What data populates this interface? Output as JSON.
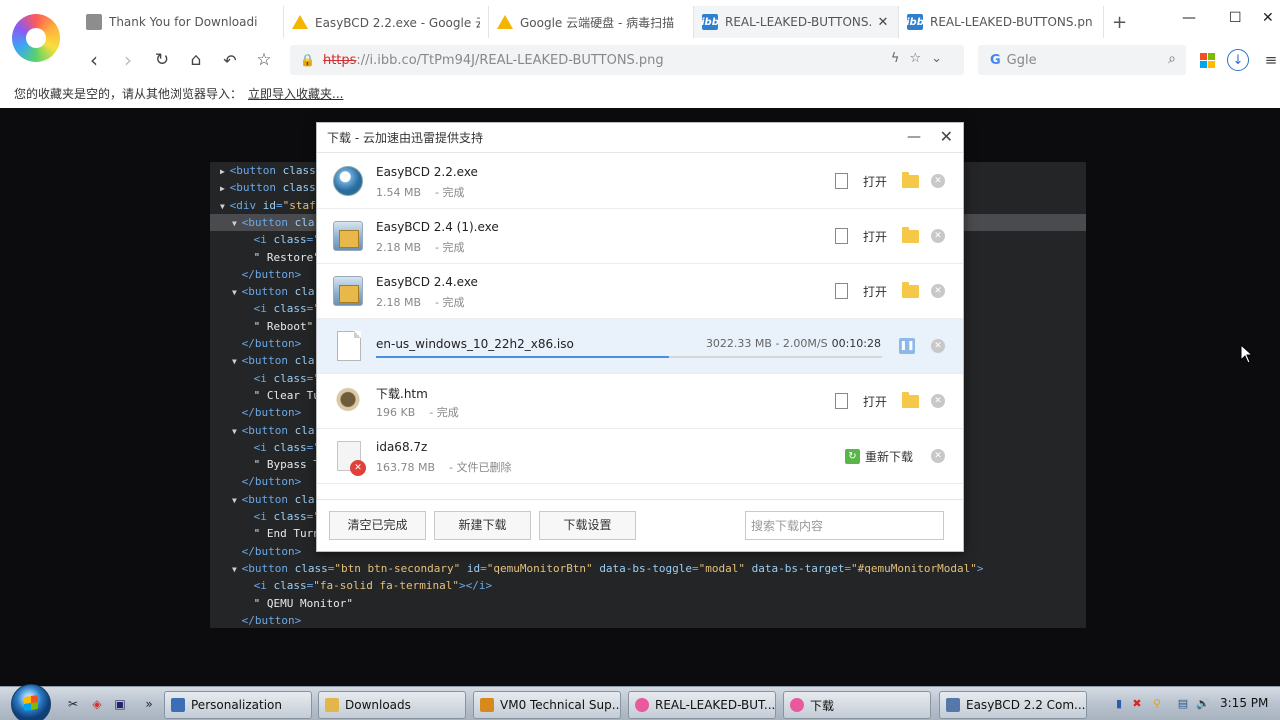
{
  "browser": {
    "tabs": [
      {
        "label": "Thank You for Downloadi",
        "favicon": "document-icon"
      },
      {
        "label": "EasyBCD 2.2.exe - Google 云",
        "favicon": "google-drive-icon"
      },
      {
        "label": "Google 云端硬盘 - 病毒扫描",
        "favicon": "google-drive-icon"
      },
      {
        "label": "REAL-LEAKED-BUTTONS.pn",
        "favicon": "ibb-icon",
        "active": true
      },
      {
        "label": "REAL-LEAKED-BUTTONS.pn",
        "favicon": "ibb-icon"
      }
    ],
    "new_tab": "+",
    "address": {
      "scheme": "https",
      "rest": "://i.ibb.co/TtPm94J/REAL-LEAKED-BUTTONS.png"
    },
    "search": {
      "engine_glyph": "G",
      "placeholder": "Ggle"
    },
    "bookmark_bar": {
      "message": "您的收藏夹是空的，请从其他浏览器导入：",
      "link": "立即导入收藏夹..."
    }
  },
  "code_view": {
    "lines": [
      {
        "indent": 1,
        "triangle": "▶",
        "segments": [
          [
            "tag",
            "<button "
          ],
          [
            "attr-name",
            "class"
          ]
        ]
      },
      {
        "indent": 1,
        "triangle": "▶",
        "segments": [
          [
            "tag",
            "<button "
          ],
          [
            "attr-name",
            "class"
          ]
        ]
      },
      {
        "indent": 1,
        "triangle": "▼",
        "segments": [
          [
            "tag",
            "<div "
          ],
          [
            "attr-name",
            "id"
          ],
          [
            "tag",
            "="
          ],
          [
            "attr-val",
            "\"staf"
          ]
        ]
      },
      {
        "indent": 2,
        "triangle": "▼",
        "segments": [
          [
            "tag",
            "<button "
          ],
          [
            "attr-name",
            "cla"
          ]
        ],
        "highlight": true
      },
      {
        "indent": 3,
        "triangle": "",
        "segments": [
          [
            "tag",
            "<i "
          ],
          [
            "attr-name",
            "class"
          ],
          [
            "tag",
            "=\""
          ]
        ]
      },
      {
        "indent": 3,
        "triangle": "",
        "segments": [
          [
            "text",
            "\" Restore\""
          ]
        ]
      },
      {
        "indent": 2,
        "triangle": "",
        "segments": [
          [
            "tag",
            "</button>"
          ]
        ]
      },
      {
        "indent": 2,
        "triangle": "▼",
        "segments": [
          [
            "tag",
            "<button "
          ],
          [
            "attr-name",
            "cla"
          ]
        ]
      },
      {
        "indent": 3,
        "triangle": "",
        "segments": [
          [
            "tag",
            "<i "
          ],
          [
            "attr-name",
            "class"
          ],
          [
            "tag",
            "=\""
          ]
        ]
      },
      {
        "indent": 3,
        "triangle": "",
        "segments": [
          [
            "text",
            "\" Reboot\""
          ]
        ]
      },
      {
        "indent": 2,
        "triangle": "",
        "segments": [
          [
            "tag",
            "</button>"
          ]
        ]
      },
      {
        "indent": 2,
        "triangle": "▼",
        "segments": [
          [
            "tag",
            "<button "
          ],
          [
            "attr-name",
            "cla"
          ]
        ]
      },
      {
        "indent": 3,
        "triangle": "",
        "segments": [
          [
            "tag",
            "<i "
          ],
          [
            "attr-name",
            "class"
          ],
          [
            "tag",
            "=\""
          ]
        ]
      },
      {
        "indent": 3,
        "triangle": "",
        "segments": [
          [
            "text",
            "\" Clear Tu"
          ]
        ]
      },
      {
        "indent": 2,
        "triangle": "",
        "segments": [
          [
            "tag",
            "</button>"
          ]
        ]
      },
      {
        "indent": 2,
        "triangle": "▼",
        "segments": [
          [
            "tag",
            "<button "
          ],
          [
            "attr-name",
            "cla"
          ]
        ]
      },
      {
        "indent": 3,
        "triangle": "",
        "segments": [
          [
            "tag",
            "<i "
          ],
          [
            "attr-name",
            "class"
          ],
          [
            "tag",
            "=\""
          ]
        ]
      },
      {
        "indent": 3,
        "triangle": "",
        "segments": [
          [
            "text",
            "\" Bypass T"
          ]
        ]
      },
      {
        "indent": 2,
        "triangle": "",
        "segments": [
          [
            "tag",
            "</button>"
          ]
        ]
      },
      {
        "indent": 2,
        "triangle": "▼",
        "segments": [
          [
            "tag",
            "<button "
          ],
          [
            "attr-name",
            "cla"
          ]
        ]
      },
      {
        "indent": 3,
        "triangle": "",
        "segments": [
          [
            "tag",
            "<i "
          ],
          [
            "attr-name",
            "class"
          ],
          [
            "tag",
            "=\""
          ]
        ]
      },
      {
        "indent": 3,
        "triangle": "",
        "segments": [
          [
            "text",
            "\" End Turn"
          ]
        ]
      },
      {
        "indent": 2,
        "triangle": "",
        "segments": [
          [
            "tag",
            "</button>"
          ]
        ]
      },
      {
        "indent": 2,
        "triangle": "▼",
        "segments": [
          [
            "tag",
            "<button "
          ],
          [
            "attr-name",
            "class"
          ],
          [
            "tag",
            "="
          ],
          [
            "attr-val",
            "\"btn btn-secondary\""
          ],
          [
            "tag",
            " "
          ],
          [
            "attr-name",
            "id"
          ],
          [
            "tag",
            "="
          ],
          [
            "attr-val",
            "\"qemuMonitorBtn\""
          ],
          [
            "tag",
            " "
          ],
          [
            "attr-name",
            "data-bs-toggle"
          ],
          [
            "tag",
            "="
          ],
          [
            "attr-val",
            "\"modal\""
          ],
          [
            "tag",
            " "
          ],
          [
            "attr-name",
            "data-bs-target"
          ],
          [
            "tag",
            "="
          ],
          [
            "attr-val",
            "\"#qemuMonitorModal\""
          ],
          [
            "tag",
            ">"
          ]
        ]
      },
      {
        "indent": 3,
        "triangle": "",
        "segments": [
          [
            "tag",
            "<i "
          ],
          [
            "attr-name",
            "class"
          ],
          [
            "tag",
            "="
          ],
          [
            "attr-val",
            "\"fa-solid fa-terminal\""
          ],
          [
            "tag",
            "></i>"
          ]
        ]
      },
      {
        "indent": 3,
        "triangle": "",
        "segments": [
          [
            "text",
            "\" QEMU Monitor\""
          ]
        ]
      },
      {
        "indent": 2,
        "triangle": "",
        "segments": [
          [
            "tag",
            "</button>"
          ]
        ]
      }
    ]
  },
  "download_dialog": {
    "title": "下载 - 云加速由迅雷提供支持",
    "minimize": "—",
    "close": "✕",
    "open_label": "打开",
    "items": [
      {
        "name": "EasyBCD 2.2.exe",
        "size": "1.54 MB",
        "status": "- 完成",
        "icon": "easybcd-icon"
      },
      {
        "name": "EasyBCD 2.4 (1).exe",
        "size": "2.18 MB",
        "status": "- 完成",
        "icon": "installer-icon"
      },
      {
        "name": "EasyBCD 2.4.exe",
        "size": "2.18 MB",
        "status": "- 完成",
        "icon": "installer-icon"
      },
      {
        "name": "en-us_windows_10_22h2_x86.iso",
        "progress_text": "3022.33 MB - 2.00M/S",
        "elapsed": "00:10:28",
        "progress": 0.58,
        "icon": "iso-file-icon",
        "in_progress": true
      },
      {
        "name": "下载.htm",
        "size": "196 KB",
        "status": "- 完成",
        "icon": "htm-icon"
      },
      {
        "name": "ida68.7z",
        "size": "163.78 MB",
        "status": "- 文件已删除",
        "icon": "deleted-file-icon",
        "deleted": true,
        "redownload_label": "重新下载"
      }
    ],
    "footer": {
      "clear_completed": "清空已完成",
      "new_download": "新建下载",
      "settings": "下载设置",
      "search_placeholder": "搜索下载内容"
    }
  },
  "taskbar": {
    "buttons": [
      {
        "label": "Personalization",
        "icon_color": "#3a6fb5"
      },
      {
        "label": "Downloads",
        "icon_color": "#e2b64a"
      },
      {
        "label": "VM0 Technical Sup...",
        "icon_color": "#d8891e"
      },
      {
        "label": "REAL-LEAKED-BUT...",
        "icon_color": "#e85a9c"
      },
      {
        "label": "下载",
        "icon_color": "#e85a9c"
      },
      {
        "label": "EasyBCD 2.2  Com...",
        "icon_color": "#5577aa"
      }
    ],
    "clock": "3:15 PM"
  }
}
